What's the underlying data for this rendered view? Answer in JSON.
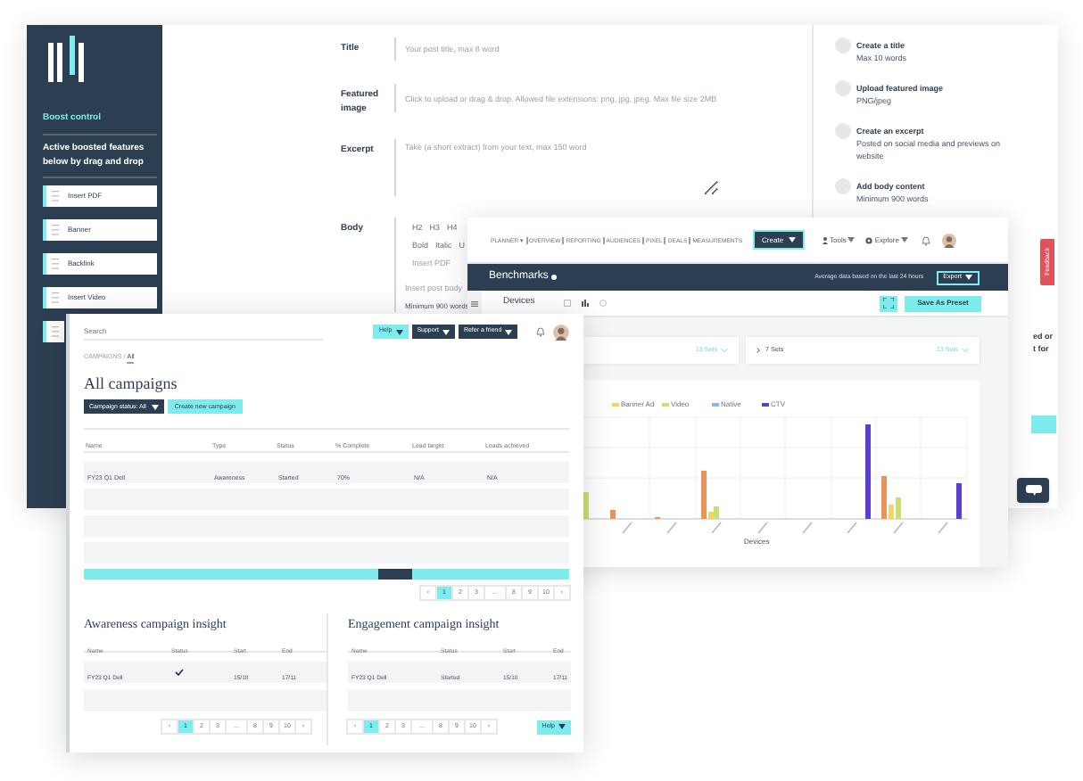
{
  "editor": {
    "sidebar": {
      "title": "Boost control",
      "description": "Active boosted features below by drag and drop",
      "items": [
        {
          "kind": "feature",
          "label": "Insert PDF"
        },
        {
          "kind": "feature",
          "label": "Banner"
        },
        {
          "kind": "feature",
          "label": "Backlink"
        },
        {
          "kind": "feature",
          "label": "Insert Video"
        },
        {
          "kind": "blank"
        }
      ]
    },
    "fields": [
      {
        "kind": "input",
        "label": "Title",
        "placeholder": "Your post title, max 8 word"
      },
      {
        "kind": "input",
        "label": "Featured image",
        "placeholder": "Click to upload or drag & drop. Allowed file extensions: png, jpg, jpeg. Max file size 2MB"
      },
      {
        "kind": "textarea",
        "label": "Excerpt",
        "placeholder": "Take (a short extract) from your text, max 150 word"
      },
      {
        "kind": "body",
        "label": "Body",
        "toolbar": [
          [
            "H2",
            "H3",
            "H4"
          ],
          [
            "Bold",
            "Italic",
            "U"
          ],
          [
            "Insert PDF"
          ]
        ],
        "placeholder": "Insert post body",
        "hint": "Minimum 900 words"
      }
    ],
    "steps": [
      {
        "title": "Create a title",
        "detail": "Max 10 words"
      },
      {
        "title": "Upload featured image",
        "detail": "PNG/jpeg"
      },
      {
        "title": "Create an excerpt",
        "detail": "Posted on social media and previews on website"
      },
      {
        "title": "Add body content",
        "detail": "Minimum 900 words"
      }
    ],
    "cut_text": [
      "ed or",
      "t for"
    ],
    "feedback": "Feedback"
  },
  "analytics": {
    "nav": [
      "PLANNER ▾",
      "OVERVIEW",
      "REPORTING",
      "AUDIENCES",
      "PIXEL",
      "DEALS",
      "MEASUREMENTS"
    ],
    "create": "Create",
    "tools": "Tools",
    "explore": "Explore",
    "title": "Benchmarks",
    "note": "Average data based on the last 24 hours",
    "export": "Export",
    "section": "Devices",
    "preset": "Save As Preset",
    "filters": [
      {
        "value": "13 Sets"
      },
      {
        "label": "7 Sets",
        "value": "13 Sets"
      }
    ],
    "legend": [
      {
        "label": "Banner Ad",
        "color": "#f3d36b"
      },
      {
        "label": "Video",
        "color": "#c9df74"
      },
      {
        "label": "Native",
        "color": "#8fb6ea"
      },
      {
        "label": "CTV",
        "color": "#5a3fd2"
      }
    ],
    "x_label": "Devices"
  },
  "campaigns": {
    "search": {
      "placeholder": "Search"
    },
    "buttons": [
      "Help",
      "Support",
      "Refer a friend"
    ],
    "breadcrumb": [
      {
        "label": "CAMPAIGNS /",
        "selected": false
      },
      {
        "label": "All",
        "selected": true
      }
    ],
    "title": "All campaigns",
    "filter": "Campaign status: All",
    "create": "Create new campaign",
    "table": {
      "columns": [
        "Name",
        "Type",
        "Status",
        "% Complete",
        "Lead target",
        "Leads achieved"
      ],
      "rows": [
        [
          "FY23 Q1 Dell",
          "Awareness",
          "Started",
          "70%",
          "N/A",
          "N/A"
        ]
      ]
    },
    "pagination": [
      {
        "label": "‹",
        "selected": false
      },
      {
        "label": "1",
        "selected": true
      },
      {
        "label": "2",
        "selected": false
      },
      {
        "label": "3",
        "selected": false
      },
      {
        "label": "...",
        "selected": false
      },
      {
        "label": "8",
        "selected": false
      },
      {
        "label": "9",
        "selected": false
      },
      {
        "label": "10",
        "selected": false
      },
      {
        "label": "›",
        "selected": false
      }
    ],
    "insights": [
      {
        "title": "Awareness campaign insight",
        "columns": [
          "Name",
          "Status",
          "Start",
          "End"
        ],
        "rows": [
          [
            {
              "kind": "text",
              "text": "FY23 Q1 Dell"
            },
            {
              "kind": "check",
              "checked": true
            },
            {
              "kind": "text",
              "text": "15/18"
            },
            {
              "kind": "text",
              "text": "17/11"
            }
          ]
        ],
        "pagination": [
          {
            "label": "‹",
            "selected": false
          },
          {
            "label": "1",
            "selected": true
          },
          {
            "label": "2",
            "selected": false
          },
          {
            "label": "3",
            "selected": false
          },
          {
            "label": "...",
            "selected": false
          },
          {
            "label": "8",
            "selected": false
          },
          {
            "label": "9",
            "selected": false
          },
          {
            "label": "10",
            "selected": false
          },
          {
            "label": "›",
            "selected": false
          }
        ]
      },
      {
        "title": "Engagement campaign insight",
        "columns": [
          "Name",
          "Status",
          "Start",
          "End"
        ],
        "rows": [
          [
            {
              "kind": "text",
              "text": "FY23 Q1 Dell"
            },
            {
              "kind": "text",
              "text": "Started"
            },
            {
              "kind": "text",
              "text": "15/18"
            },
            {
              "kind": "text",
              "text": "17/11"
            }
          ]
        ],
        "pagination": [
          {
            "label": "‹",
            "selected": false
          },
          {
            "label": "1",
            "selected": true
          },
          {
            "label": "2",
            "selected": false
          },
          {
            "label": "3",
            "selected": false
          },
          {
            "label": "...",
            "selected": false
          },
          {
            "label": "8",
            "selected": false
          },
          {
            "label": "9",
            "selected": false
          },
          {
            "label": "10",
            "selected": false
          },
          {
            "label": "›",
            "selected": false
          }
        ],
        "help": "Help"
      }
    ]
  }
}
